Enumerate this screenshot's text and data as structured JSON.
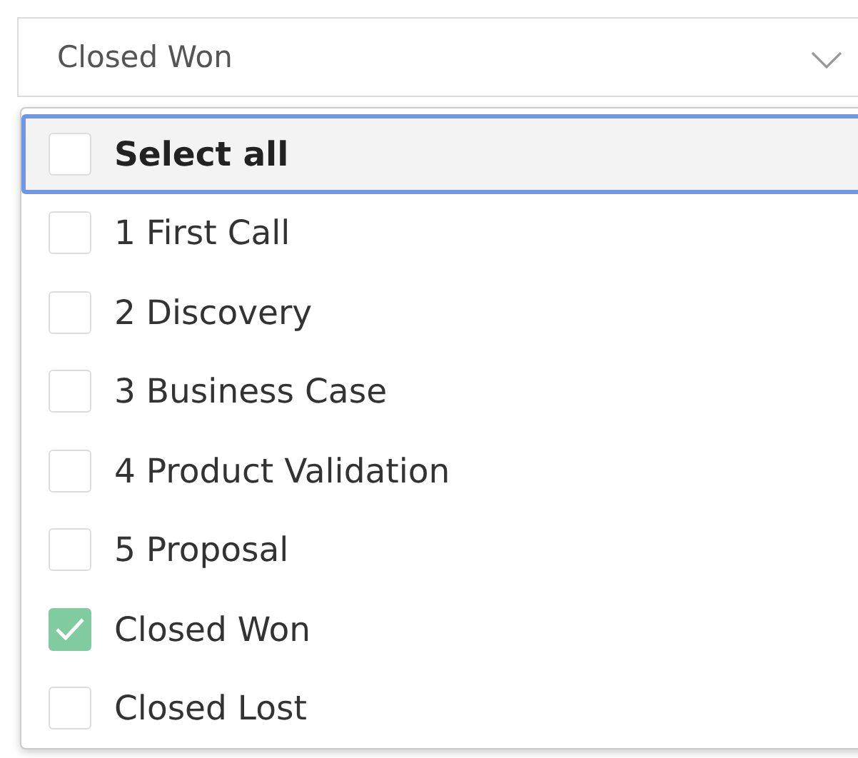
{
  "select": {
    "value": "Closed Won"
  },
  "options": [
    {
      "label": "Select all",
      "kind": "all",
      "checked": false,
      "focused": true
    },
    {
      "label": "1 First Call",
      "kind": "option",
      "checked": false,
      "focused": false
    },
    {
      "label": "2 Discovery",
      "kind": "option",
      "checked": false,
      "focused": false
    },
    {
      "label": "3 Business Case",
      "kind": "option",
      "checked": false,
      "focused": false
    },
    {
      "label": "4 Product Validation",
      "kind": "option",
      "checked": false,
      "focused": false
    },
    {
      "label": "5 Proposal",
      "kind": "option",
      "checked": false,
      "focused": false
    },
    {
      "label": "Closed Won",
      "kind": "option",
      "checked": true,
      "focused": false
    },
    {
      "label": "Closed Lost",
      "kind": "option",
      "checked": false,
      "focused": false
    }
  ]
}
